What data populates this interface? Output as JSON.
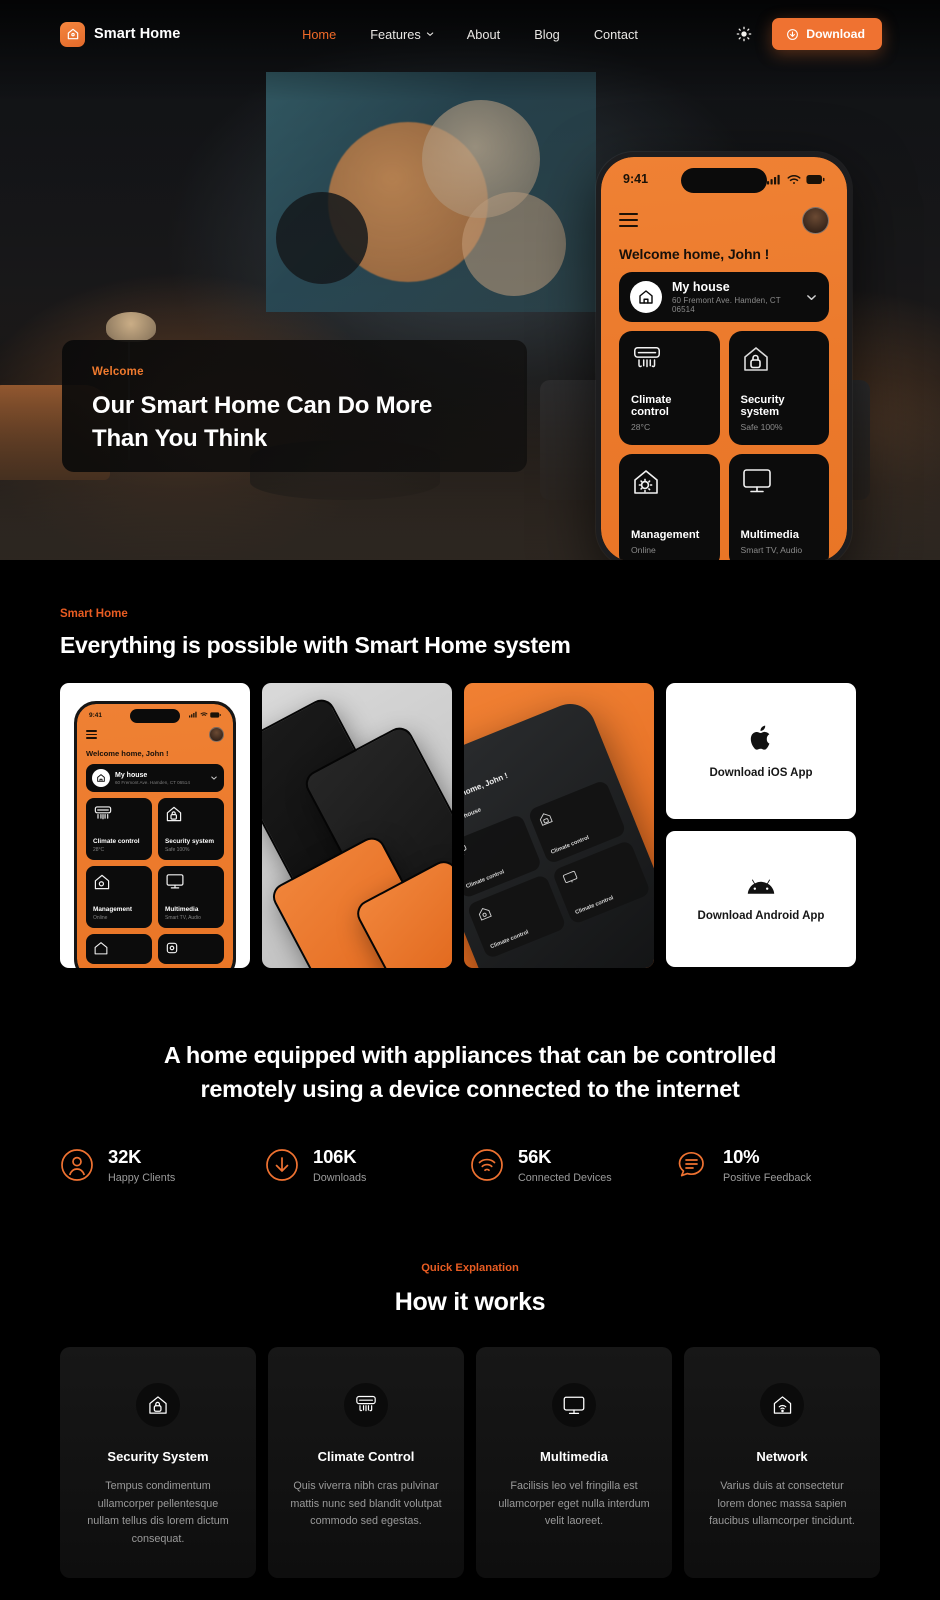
{
  "nav": {
    "brand": "Smart Home",
    "brand_icon": "home-logo-icon",
    "links": [
      {
        "label": "Home",
        "active": true
      },
      {
        "label": "Features",
        "active": false,
        "has_caret": true
      },
      {
        "label": "About",
        "active": false
      },
      {
        "label": "Blog",
        "active": false
      },
      {
        "label": "Contact",
        "active": false
      }
    ],
    "theme_icon": "sun-icon",
    "download_label": "Download",
    "download_icon": "download-circle-icon",
    "accent": "#ef7231"
  },
  "hero": {
    "eyebrow": "Welcome",
    "title_line1": "Our Smart Home Can Do More",
    "title_line2": "Than You Think",
    "phone": {
      "time": "9:41",
      "greeting": "Welcome home, John !",
      "house_name": "My house",
      "house_address": "60 Fremont Ave. Hamden, CT 06514",
      "tiles": [
        {
          "title": "Climate control",
          "sub": "28°C",
          "icon": "air-conditioner-icon"
        },
        {
          "title": "Security system",
          "sub": "Safe 100%",
          "icon": "house-lock-icon"
        },
        {
          "title": "Management",
          "sub": "Online",
          "icon": "house-gear-icon"
        },
        {
          "title": "Multimedia",
          "sub": "Smart TV, Audio",
          "icon": "monitor-icon"
        }
      ]
    }
  },
  "features_section": {
    "eyebrow": "Smart Home",
    "title": "Everything is possible with Smart Home system",
    "gallery": [
      {
        "name": "app-screenshot-light-card"
      },
      {
        "name": "tilted-phones-card"
      },
      {
        "name": "orange-phone-card"
      }
    ],
    "stores": [
      {
        "label": "Download iOS App",
        "icon": "apple-icon"
      },
      {
        "label": "Download Android App",
        "icon": "android-icon"
      }
    ]
  },
  "stats_section": {
    "headline_line1": "A home equipped with appliances that can be controlled",
    "headline_line2": "remotely using a device connected to the internet",
    "stats": [
      {
        "value": "32K",
        "label": "Happy Clients",
        "icon": "user-circle-icon"
      },
      {
        "value": "106K",
        "label": "Downloads",
        "icon": "download-circle-icon"
      },
      {
        "value": "56K",
        "label": "Connected Devices",
        "icon": "wifi-circle-icon"
      },
      {
        "value": "10%",
        "label": "Positive Feedback",
        "icon": "chat-bubble-icon"
      }
    ]
  },
  "how_section": {
    "eyebrow": "Quick Explanation",
    "title": "How it works",
    "cards": [
      {
        "title": "Security System",
        "icon": "house-lock-icon",
        "body": "Tempus condimentum ullamcorper pellentesque nullam tellus dis lorem dictum consequat."
      },
      {
        "title": "Climate Control",
        "icon": "air-conditioner-icon",
        "body": "Quis viverra nibh cras pulvinar mattis nunc sed blandit volutpat commodo sed egestas."
      },
      {
        "title": "Multimedia",
        "icon": "monitor-icon",
        "body": "Facilisis leo vel fringilla est ullamcorper eget nulla interdum velit laoreet."
      },
      {
        "title": "Network",
        "icon": "wifi-house-icon",
        "body": "Varius duis at consectetur lorem donec massa sapien faucibus ullamcorper tincidunt."
      }
    ]
  }
}
